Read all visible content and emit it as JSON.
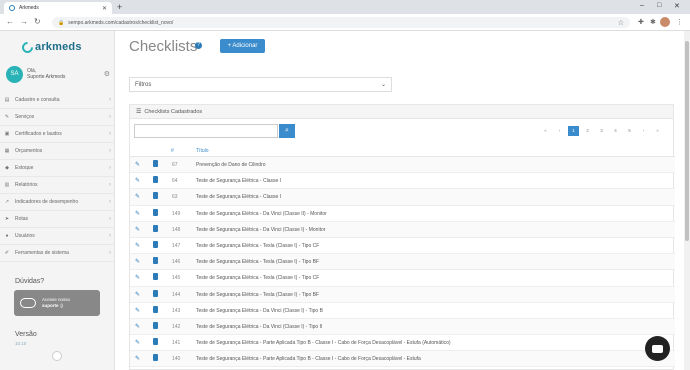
{
  "browser": {
    "tab_title": "Arkmeds",
    "url": "sempo.arkmeds.com/cadastros/checklist_novo/"
  },
  "sidebar": {
    "logo_text": "arkmeds",
    "user_greeting": "Olá,",
    "user_name": "Suporte Arkmeds",
    "avatar_initials": "SA",
    "items": [
      {
        "label": "Cadastro e consulta",
        "icon": "list-icon"
      },
      {
        "label": "Serviços",
        "icon": "wrench-icon"
      },
      {
        "label": "Certificados e laudos",
        "icon": "certificate-icon"
      },
      {
        "label": "Orçamentos",
        "icon": "money-icon"
      },
      {
        "label": "Estoque",
        "icon": "box-icon"
      },
      {
        "label": "Relatórios",
        "icon": "chart-icon"
      },
      {
        "label": "Indicadores de desempenho",
        "icon": "trend-icon"
      },
      {
        "label": "Rotas",
        "icon": "route-icon"
      },
      {
        "label": "Usuários",
        "icon": "user-icon"
      },
      {
        "label": "Ferramentas de sistema",
        "icon": "tools-icon"
      }
    ],
    "doubts_label": "Dúvidas?",
    "support_line1": "Acesse nosso",
    "support_line2": "suporte :)",
    "version_label": "Versão",
    "version_number": "10.10"
  },
  "main": {
    "title": "Checklists",
    "add_button": "+ Adicionar",
    "filters_label": "Filtros",
    "panel_title": "Checklists Cadastrados",
    "search_placeholder": "",
    "columns": {
      "id": "#",
      "title": "Título"
    },
    "pager": [
      "«",
      "‹",
      "1",
      "2",
      "3",
      "4",
      "5",
      "›",
      "»"
    ],
    "rows": [
      {
        "id": "67",
        "title": "Prevenção de Dano de Cilindro"
      },
      {
        "id": "64",
        "title": "Teste de Segurança Elétrica - Classe I"
      },
      {
        "id": "63",
        "title": "Teste de Segurança Elétrica - Classe I"
      },
      {
        "id": "149",
        "title": "Teste de Segurança Elétrica - Da Vinci (Classe II) - Monitor"
      },
      {
        "id": "148",
        "title": "Teste de Segurança Elétrica - Da Vinci (Classe I) - Monitor"
      },
      {
        "id": "147",
        "title": "Teste de Segurança Elétrica - Tesla (Classe I) - Tipo CF"
      },
      {
        "id": "146",
        "title": "Teste de Segurança Elétrica - Tesla (Classe I) - Tipo BF"
      },
      {
        "id": "145",
        "title": "Teste de Segurança Elétrica - Tesla (Classe I) - Tipo CF"
      },
      {
        "id": "144",
        "title": "Teste de Segurança Elétrica - Tesla (Classe I) - Tipo BF"
      },
      {
        "id": "143",
        "title": "Teste de Segurança Elétrica - Da Vinci (Classe I) - Tipo B"
      },
      {
        "id": "142",
        "title": "Teste de Segurança Elétrica - Da Vinci (Classe I) - Tipo II"
      },
      {
        "id": "141",
        "title": "Teste de Segurança Elétrica - Parte Aplicada Tipo B - Classe I - Cabo de Força Desacoplável - Estufa (Automático)"
      },
      {
        "id": "140",
        "title": "Teste de Segurança Elétrica - Parte Aplicada Tipo B - Classe I - Cabo de Força Desacoplável - Estufa"
      }
    ]
  }
}
